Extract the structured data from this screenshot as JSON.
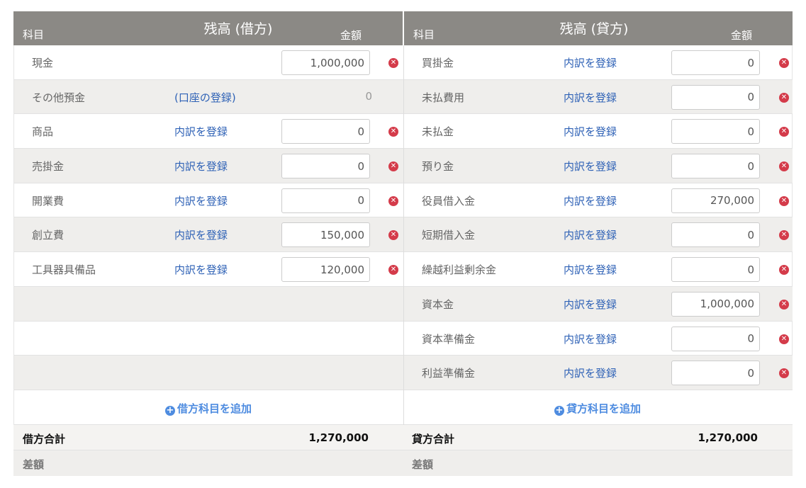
{
  "header": {
    "debit": {
      "kamoku": "科目",
      "title": "残高 (借方)",
      "kingaku": "金額"
    },
    "credit": {
      "kamoku": "科目",
      "title": "残高 (貸方)",
      "kingaku": "金額"
    }
  },
  "debit_rows": [
    {
      "label": "現金",
      "link": "",
      "amount": "1,000,000",
      "editable": true
    },
    {
      "label": "その他預金",
      "link": "(口座の登録)",
      "amount": "0",
      "editable": false
    },
    {
      "label": "商品",
      "link": "内訳を登録",
      "amount": "0",
      "editable": true
    },
    {
      "label": "売掛金",
      "link": "内訳を登録",
      "amount": "0",
      "editable": true
    },
    {
      "label": "開業費",
      "link": "内訳を登録",
      "amount": "0",
      "editable": true
    },
    {
      "label": "創立費",
      "link": "内訳を登録",
      "amount": "150,000",
      "editable": true
    },
    {
      "label": "工具器具備品",
      "link": "内訳を登録",
      "amount": "120,000",
      "editable": true
    }
  ],
  "credit_rows": [
    {
      "label": "買掛金",
      "link": "内訳を登録",
      "amount": "0"
    },
    {
      "label": "未払費用",
      "link": "内訳を登録",
      "amount": "0"
    },
    {
      "label": "未払金",
      "link": "内訳を登録",
      "amount": "0"
    },
    {
      "label": "預り金",
      "link": "内訳を登録",
      "amount": "0"
    },
    {
      "label": "役員借入金",
      "link": "内訳を登録",
      "amount": "270,000"
    },
    {
      "label": "短期借入金",
      "link": "内訳を登録",
      "amount": "0"
    },
    {
      "label": "繰越利益剰余金",
      "link": "内訳を登録",
      "amount": "0"
    },
    {
      "label": "資本金",
      "link": "内訳を登録",
      "amount": "1,000,000"
    },
    {
      "label": "資本準備金",
      "link": "内訳を登録",
      "amount": "0"
    },
    {
      "label": "利益準備金",
      "link": "内訳を登録",
      "amount": "0"
    }
  ],
  "add": {
    "debit": "借方科目を追加",
    "credit": "貸方科目を追加",
    "icon": "plus-circle-icon"
  },
  "totals": {
    "debit_label": "借方合計",
    "debit_value": "1,270,000",
    "credit_label": "貸方合計",
    "credit_value": "1,270,000"
  },
  "diff": {
    "debit_label": "差額",
    "credit_label": "差額"
  },
  "colors": {
    "header_bg": "#8b8985",
    "link": "#2f62b6",
    "delete": "#d43b4a",
    "add": "#4e8ce0",
    "row_shade": "#efeeec"
  },
  "icons": {
    "delete": "remove-circle-icon"
  }
}
